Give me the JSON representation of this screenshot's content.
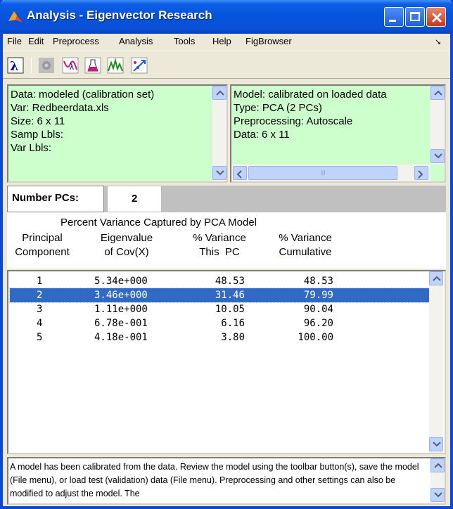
{
  "window": {
    "title": "Analysis - Eigenvector Research"
  },
  "menu": {
    "file": "File",
    "edit": "Edit",
    "preprocess": "Preprocess",
    "analysis": "Analysis",
    "tools": "Tools",
    "help": "Help",
    "figbrowser": "FigBrowser"
  },
  "toolbar": {
    "icons": [
      "lambda-icon",
      "gear-icon",
      "lambda-curve-icon",
      "flask-icon",
      "peaks-chart-icon",
      "scatter-arrow-icon"
    ]
  },
  "data_info": {
    "lines": [
      "Data: modeled (calibration set)",
      "Var: Redbeerdata.xls",
      "Size: 6 x 11",
      "Samp Lbls:",
      "Var Lbls:"
    ]
  },
  "model_info": {
    "lines": [
      "Model: calibrated on loaded data",
      "Type: PCA (2 PCs)",
      "Preprocessing: Autoscale",
      "Data: 6 x 11"
    ],
    "hscroll_grip": "III"
  },
  "numpc": {
    "label": "Number PCs:",
    "value": "2"
  },
  "variance": {
    "title": "Percent Variance Captured by PCA Model",
    "col1": [
      "Principal",
      "Component"
    ],
    "col2": [
      "Eigenvalue",
      "of Cov(X)"
    ],
    "col3": [
      "% Variance",
      "This  PC"
    ],
    "col4": [
      "% Variance",
      "Cumulative"
    ],
    "rows": [
      {
        "pc": "1",
        "eig": "5.34e+000",
        "pct": "48.53",
        "cum": "48.53"
      },
      {
        "pc": "2",
        "eig": "3.46e+000",
        "pct": "31.46",
        "cum": "79.99"
      },
      {
        "pc": "3",
        "eig": "1.11e+000",
        "pct": "10.05",
        "cum": "90.04"
      },
      {
        "pc": "4",
        "eig": "6.78e-001",
        "pct": "6.16",
        "cum": "96.20"
      },
      {
        "pc": "5",
        "eig": "4.18e-001",
        "pct": "3.80",
        "cum": "100.00"
      }
    ],
    "selected_row": 2
  },
  "message": {
    "text": "A model has been calibrated from the data. Review the model using the toolbar button(s), save the model (File menu), or load test (validation) data (File menu). Preprocessing and other settings can also be modified to adjust the model. The"
  },
  "colors": {
    "titlebar": "#0553dd",
    "info_bg": "#ccffcc",
    "selection": "#316ac5"
  }
}
